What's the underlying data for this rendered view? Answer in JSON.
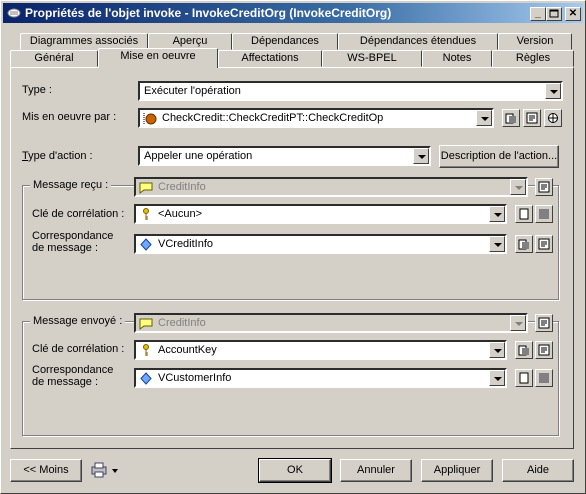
{
  "window": {
    "title": "Propriétés de l'objet invoke - InvokeCreditOrg (InvokeCreditOrg)"
  },
  "tabs_back": [
    "Diagrammes associés",
    "Aperçu",
    "Dépendances",
    "Dépendances étendues",
    "Version"
  ],
  "tabs_front": [
    "Général",
    "Mise en oeuvre",
    "Affectations",
    "WS-BPEL",
    "Notes",
    "Règles"
  ],
  "active_tab": "Mise en oeuvre",
  "form": {
    "type_label": "Type :",
    "type_value": "Exécuter l'opération",
    "impl_label": "Mis en oeuvre par :",
    "impl_value": "CheckCredit::CheckCreditPT::CheckCreditOp",
    "action_label": "Type d'action :",
    "action_value": "Appeler une opération",
    "action_desc_button": "Description de l'action..."
  },
  "received": {
    "title": "Message reçu :",
    "message_value": "CreditInfo",
    "corr_label": "Clé de corrélation :",
    "corr_value": "<Aucun>",
    "mapping_label_1": "Correspondance",
    "mapping_label_2": "de message :",
    "mapping_value": "VCreditInfo"
  },
  "sent": {
    "title": "Message envoyé :",
    "message_value": "CreditInfo",
    "corr_label": "Clé de corrélation :",
    "corr_value": "AccountKey",
    "mapping_label_1": "Correspondance",
    "mapping_label_2": "de message :",
    "mapping_value": "VCustomerInfo"
  },
  "footer": {
    "less_button": "<< Moins",
    "ok_button": "OK",
    "cancel_button": "Annuler",
    "apply_button": "Appliquer",
    "help_button": "Aide"
  }
}
